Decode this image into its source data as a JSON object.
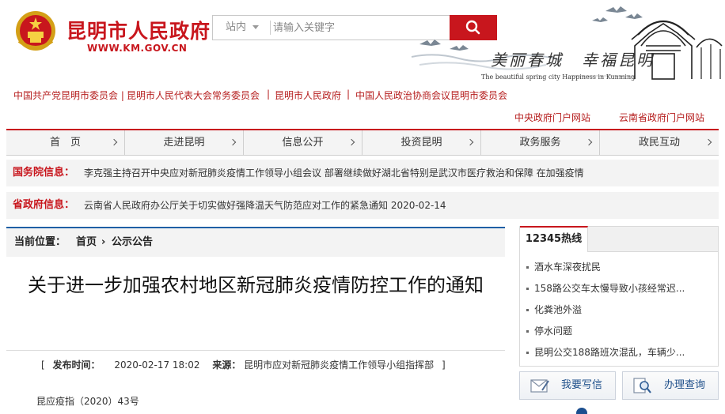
{
  "header": {
    "site_title": "昆明市人民政府",
    "site_url": "WWW.KM.GOV.CN",
    "search": {
      "scope": "站内",
      "placeholder": "请输入关键字"
    },
    "slogan": "美丽春城　幸福昆明",
    "slogan_en": "The beautiful spring city  Happiness in Kunming"
  },
  "top_links": [
    "中国共产党昆明市委员会 |",
    "昆明市人民代表大会常务委员会",
    "|",
    "昆明市人民政府",
    "|",
    "中国人民政治协商会议昆明市委员会"
  ],
  "gov_links": [
    "中央政府门户网站",
    "云南省政府门户网站"
  ],
  "nav": [
    {
      "label": "首　页"
    },
    {
      "label": "走进昆明"
    },
    {
      "label": "信息公开"
    },
    {
      "label": "投资昆明"
    },
    {
      "label": "政务服务"
    },
    {
      "label": "政民互动"
    }
  ],
  "info": [
    {
      "label": "国务院信息：",
      "text": "李克强主持召开中央应对新冠肺炎疫情工作领导小组会议 部署继续做好湖北省特别是武汉市医疗救治和保障 在加强疫情"
    },
    {
      "label": "省政府信息：",
      "text": "云南省人民政府办公厅关于切实做好强降温天气防范应对工作的紧急通知  2020-02-14"
    }
  ],
  "breadcrumb": {
    "label": "当前位置：",
    "home": "首页",
    "sep": "›",
    "current": "公示公告"
  },
  "article": {
    "title": "关于进一步加强农村地区新冠肺炎疫情防控工作的通知",
    "publish_label": "发布时间：",
    "publish_time": "2020-02-17 18:02",
    "source_label": "来源：",
    "source": "昆明市应对新冠肺炎疫情工作领导小组指挥部",
    "bracket_open": "[",
    "bracket_close": "]",
    "doc_no": "昆应疫指（2020）43号"
  },
  "sidebar": {
    "tab": "12345热线",
    "items": [
      "酒水车深夜扰民",
      "158路公交车太慢导致小孩经常迟...",
      "化粪池外溢",
      "停水问题",
      "昆明公交188路班次混乱，车辆少..."
    ],
    "buttons": [
      "我要写信",
      "办理查询"
    ]
  },
  "colors": {
    "brand_red": "#c8161d",
    "link_red": "#b51c1c",
    "blue": "#1f5fa5"
  },
  "icons": [
    "national-emblem-icon",
    "search-icon",
    "chevron-right-icon",
    "letter-icon",
    "query-icon"
  ]
}
